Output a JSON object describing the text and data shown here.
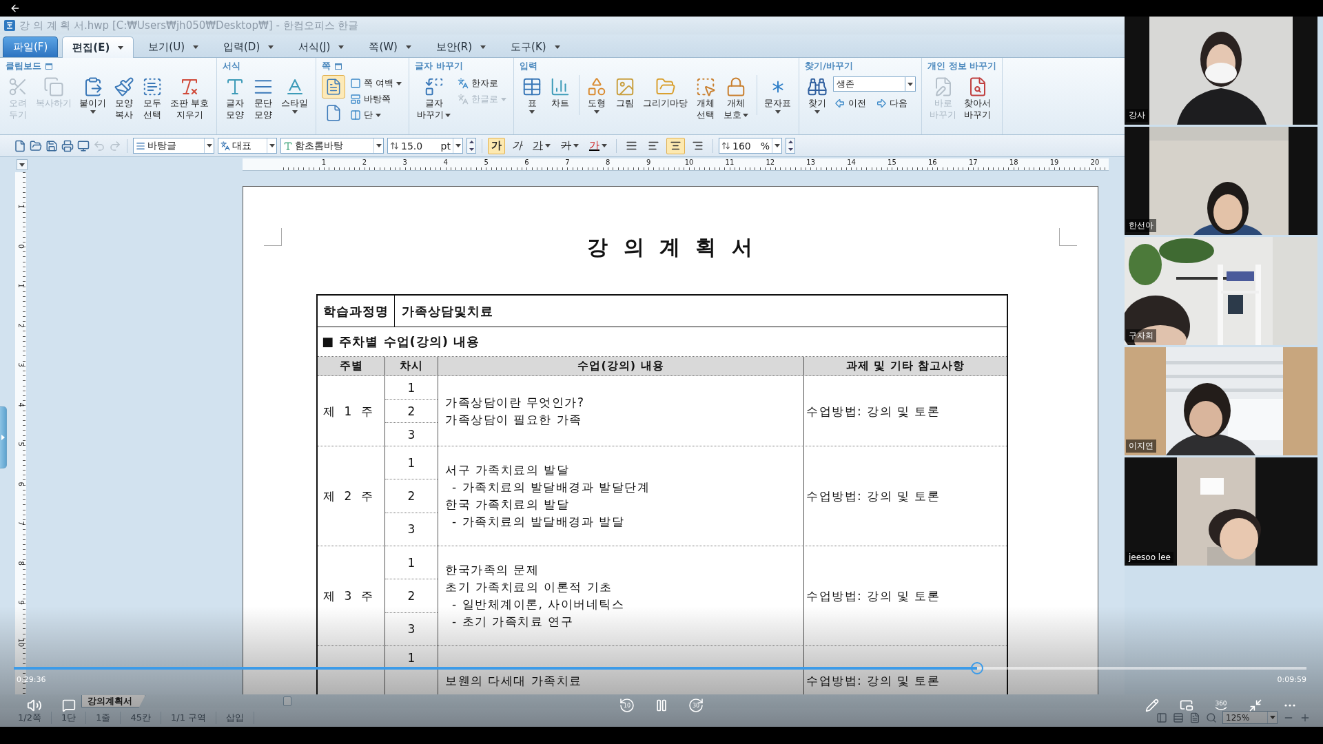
{
  "player": {
    "progress": {
      "level": 0.745
    },
    "elapsed": "0:29:36",
    "remaining": "0:09:59",
    "rewind_seconds": "10",
    "forward_seconds": "30",
    "vr_label": "360"
  },
  "window": {
    "title": "강 의 계 획 서.hwp [C:₩Users₩jh050₩Desktop₩] - 한컴오피스 한글"
  },
  "menu_tabs": [
    {
      "label": "파일(F)",
      "kind": "file",
      "selected": false
    },
    {
      "label": "편집(E)",
      "kind": "menu",
      "selected": true
    },
    {
      "label": "보기(U)",
      "kind": "menu",
      "selected": false
    },
    {
      "label": "입력(D)",
      "kind": "menu",
      "selected": false
    },
    {
      "label": "서식(J)",
      "kind": "menu",
      "selected": false
    },
    {
      "label": "쪽(W)",
      "kind": "menu",
      "selected": false
    },
    {
      "label": "보안(R)",
      "kind": "menu",
      "selected": false
    },
    {
      "label": "도구(K)",
      "kind": "menu",
      "selected": false
    }
  ],
  "ribbon": {
    "groups": [
      {
        "title": "클립보드",
        "options": true,
        "large": [
          {
            "lines": [
              "오려",
              "두기"
            ],
            "disabled": true,
            "dropdown": false
          },
          {
            "lines": [
              "복사하기"
            ],
            "disabled": true,
            "dropdown": false
          },
          {
            "lines": [
              "붙이기"
            ],
            "disabled": false,
            "dropdown": true
          },
          {
            "lines": [
              "모양",
              "복사"
            ],
            "disabled": false,
            "dropdown": false
          },
          {
            "lines": [
              "모두",
              "선택"
            ],
            "disabled": false,
            "dropdown": false
          },
          {
            "lines": [
              "조판 부호",
              "지우기"
            ],
            "disabled": false,
            "dropdown": false
          }
        ]
      },
      {
        "title": "서식",
        "options": false,
        "large": [
          {
            "lines": [
              "글자",
              "모양"
            ],
            "disabled": false,
            "dropdown": false
          },
          {
            "lines": [
              "문단",
              "모양"
            ],
            "disabled": false,
            "dropdown": false
          },
          {
            "lines": [
              "스타일"
            ],
            "disabled": false,
            "dropdown": true
          }
        ]
      },
      {
        "title": "쪽",
        "options": true,
        "page_icons": [
          {
            "selected": true
          },
          {
            "selected": false
          }
        ],
        "small": [
          {
            "label": "쪽 여백",
            "disabled": false,
            "dropdown": true
          },
          {
            "label": "바탕쪽",
            "disabled": false,
            "dropdown": false
          },
          {
            "label": "단",
            "disabled": false,
            "dropdown": true
          }
        ]
      },
      {
        "title": "글자 바꾸기",
        "options": false,
        "large": [
          {
            "lines": [
              "글자",
              "바꾸기"
            ],
            "disabled": false,
            "dropdown": true
          }
        ],
        "small": [
          {
            "label": "한자로",
            "disabled": false,
            "dropdown": false
          },
          {
            "label": "한글로",
            "disabled": true,
            "dropdown": true
          }
        ]
      },
      {
        "title": "입력",
        "options": false,
        "large": [
          {
            "lines": [
              "표"
            ],
            "disabled": false,
            "dropdown": true,
            "group_break": false
          },
          {
            "lines": [
              "차트"
            ],
            "disabled": false,
            "dropdown": false,
            "group_break": false
          },
          {
            "lines": [
              "도형"
            ],
            "disabled": false,
            "dropdown": true,
            "group_break": true
          },
          {
            "lines": [
              "그림"
            ],
            "disabled": false,
            "dropdown": false,
            "group_break": false
          },
          {
            "lines": [
              "그리기마당"
            ],
            "disabled": false,
            "dropdown": false,
            "group_break": false
          },
          {
            "lines": [
              "개체",
              "선택"
            ],
            "disabled": false,
            "dropdown": false,
            "group_break": false
          },
          {
            "lines": [
              "개체",
              "보호"
            ],
            "disabled": false,
            "dropdown": true,
            "group_break": false
          },
          {
            "lines": [
              "문자표"
            ],
            "disabled": false,
            "dropdown": true,
            "group_break": true
          }
        ]
      },
      {
        "title": "찾기/바꾸기",
        "options": false,
        "large": [
          {
            "lines": [
              "찾기"
            ],
            "disabled": false,
            "dropdown": true
          }
        ],
        "field": {
          "value": "생존"
        },
        "small": [
          {
            "label": "이전",
            "disabled": false,
            "dropdown": false
          },
          {
            "label": "다음",
            "disabled": false,
            "dropdown": false
          }
        ]
      },
      {
        "title": "개인 정보 바꾸기",
        "options": false,
        "large": [
          {
            "lines": [
              "바로",
              "바꾸기"
            ],
            "disabled": true,
            "dropdown": false
          },
          {
            "lines": [
              "찾아서",
              "바꾸기"
            ],
            "disabled": false,
            "dropdown": false
          }
        ]
      }
    ]
  },
  "format_bar": {
    "quick": [
      {
        "kind": "new",
        "disabled": false
      },
      {
        "kind": "open",
        "disabled": false
      },
      {
        "kind": "save",
        "disabled": false
      },
      {
        "kind": "print",
        "disabled": false
      },
      {
        "kind": "preview",
        "disabled": false
      },
      {
        "kind": "undo",
        "disabled": true
      },
      {
        "kind": "redo",
        "disabled": true
      }
    ],
    "style": "바탕글",
    "language": "대표",
    "font": "함초롬바탕",
    "size": "15.0",
    "size_unit": "pt",
    "char_buttons": [
      {
        "kind": "bold",
        "label": "가",
        "selected": true,
        "dropdown": false
      },
      {
        "kind": "italic",
        "label": "가",
        "selected": false,
        "dropdown": false
      },
      {
        "kind": "underline",
        "label": "가",
        "selected": false,
        "dropdown": true
      },
      {
        "kind": "strike",
        "label": "가",
        "selected": false,
        "dropdown": true
      },
      {
        "kind": "color",
        "label": "가",
        "selected": false,
        "dropdown": true
      }
    ],
    "align": [
      {
        "kind": "justify",
        "selected": false
      },
      {
        "kind": "left",
        "selected": false
      },
      {
        "kind": "center",
        "selected": true
      },
      {
        "kind": "right",
        "selected": false
      }
    ],
    "line_spacing": "160",
    "line_spacing_unit": "%"
  },
  "ruler": {
    "marks": [
      "1",
      "2",
      "3",
      "4",
      "5",
      "6",
      "7",
      "8",
      "9",
      "10",
      "11",
      "12",
      "13",
      "14",
      "15",
      "16",
      "17",
      "18",
      "19",
      "20"
    ]
  },
  "vertical_ruler": {
    "marks": [
      "1",
      "0",
      "1",
      "2",
      "3",
      "4",
      "5",
      "6",
      "7",
      "8",
      "9",
      "10"
    ]
  },
  "document": {
    "title": "강 의 계 획 서",
    "course_label": "학습과정명",
    "course_name": "가족상담및치료",
    "section": "■ 주차별 수업(강의) 내용",
    "columns": [
      "주별",
      "차시",
      "수업(강의) 내용",
      "과제 및 기타 참고사항"
    ],
    "weeks": [
      {
        "label": "제 1 주",
        "sessions": [
          "1",
          "2",
          "3"
        ],
        "lines": [
          {
            "text": "가족상담이란 무엇인가?",
            "indent": false
          },
          {
            "text": "가족상담이 필요한 가족",
            "indent": false
          }
        ],
        "note": "수업방법: 강의 및 토론"
      },
      {
        "label": "제 2 주",
        "sessions": [
          "1",
          "2",
          "3"
        ],
        "lines": [
          {
            "text": "서구 가족치료의 발달",
            "indent": false
          },
          {
            "text": "- 가족치료의 발달배경과 발달단계",
            "indent": true
          },
          {
            "text": "한국 가족치료의 발달",
            "indent": false
          },
          {
            "text": "- 가족치료의 발달배경과 발달",
            "indent": true
          }
        ],
        "note": "수업방법: 강의 및 토론"
      },
      {
        "label": "제 3 주",
        "sessions": [
          "1",
          "2",
          "3"
        ],
        "lines": [
          {
            "text": "한국가족의 문제",
            "indent": false
          },
          {
            "text": "초기 가족치료의 이론적 기초",
            "indent": false
          },
          {
            "text": "- 일반체계이론, 사이버네틱스",
            "indent": true
          },
          {
            "text": "- 초기 가족치료 연구",
            "indent": true
          }
        ],
        "note": "수업방법: 강의 및 토론"
      },
      {
        "sessions": [
          "1"
        ],
        "lines": [
          {
            "text": "보웬의 다세대 가족치료",
            "indent": false
          }
        ],
        "note": "수업방법: 강의 및 토론"
      }
    ]
  },
  "sheet_tabs": [
    {
      "label": "강의계획서",
      "selected": true
    }
  ],
  "status_bar": {
    "items": [
      "1/2쪽",
      "1단",
      "1줄",
      "45칸",
      "1/1 구역",
      "삽입"
    ],
    "zoom": "125%"
  },
  "participants": [
    {
      "name": "강사"
    },
    {
      "name": "한선아"
    },
    {
      "name": "구자희"
    },
    {
      "name": "이지연"
    },
    {
      "name": "jeesoo lee"
    }
  ]
}
